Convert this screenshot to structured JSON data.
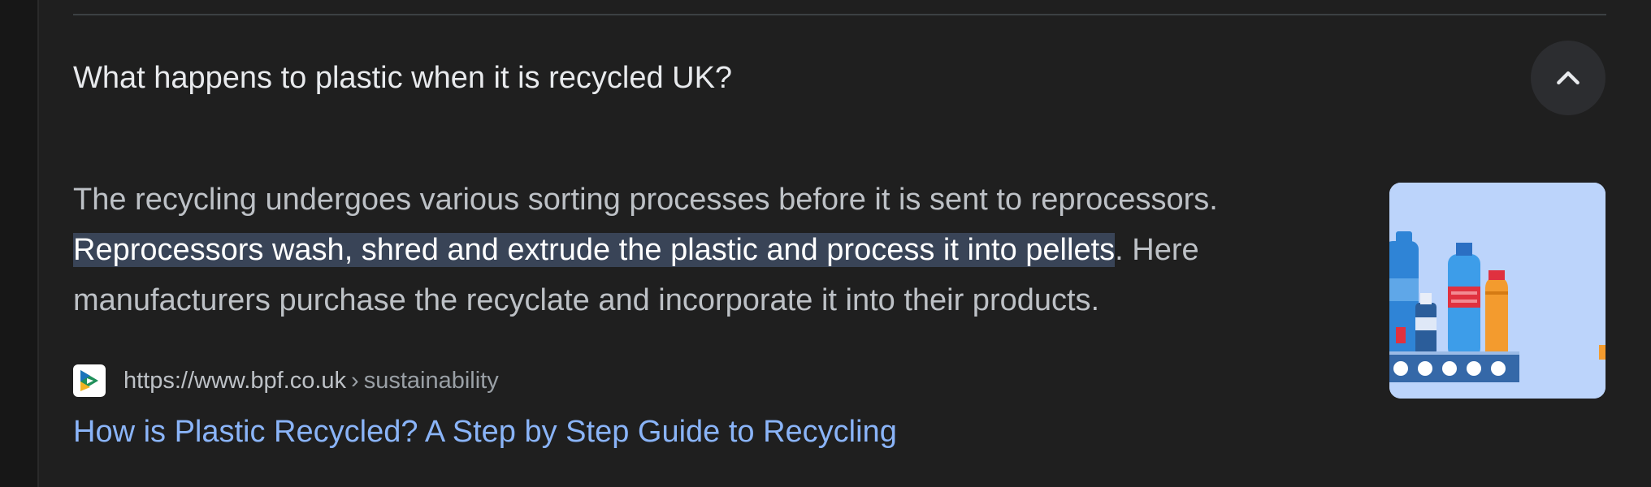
{
  "faq": {
    "question": "What happens to plastic when it is recycled UK?",
    "collapse_icon": "chevron-up-icon",
    "answer": {
      "line1": "The recycling undergoes various sorting processes before it is sent to reprocessors.",
      "line2_highlight": "Reprocessors wash, shred and extrude the plastic and process it into pellets",
      "line2_rest": ". Here",
      "line3": "manufacturers purchase the recyclate and incorporate it into their products."
    },
    "source": {
      "favicon": "bpf-logo-icon",
      "url": "https://www.bpf.co.uk",
      "separator": "›",
      "breadcrumb": "sustainability"
    },
    "link_title": "How is Plastic Recycled? A Step by Step Guide to Recycling",
    "thumbnail": "plastic-bottles-conveyor-image"
  },
  "colors": {
    "background": "#1f1f1f",
    "question_text": "#e8eaed",
    "body_text": "#bdc1c6",
    "highlight_bg": "#394457",
    "link": "#8ab4f8"
  }
}
